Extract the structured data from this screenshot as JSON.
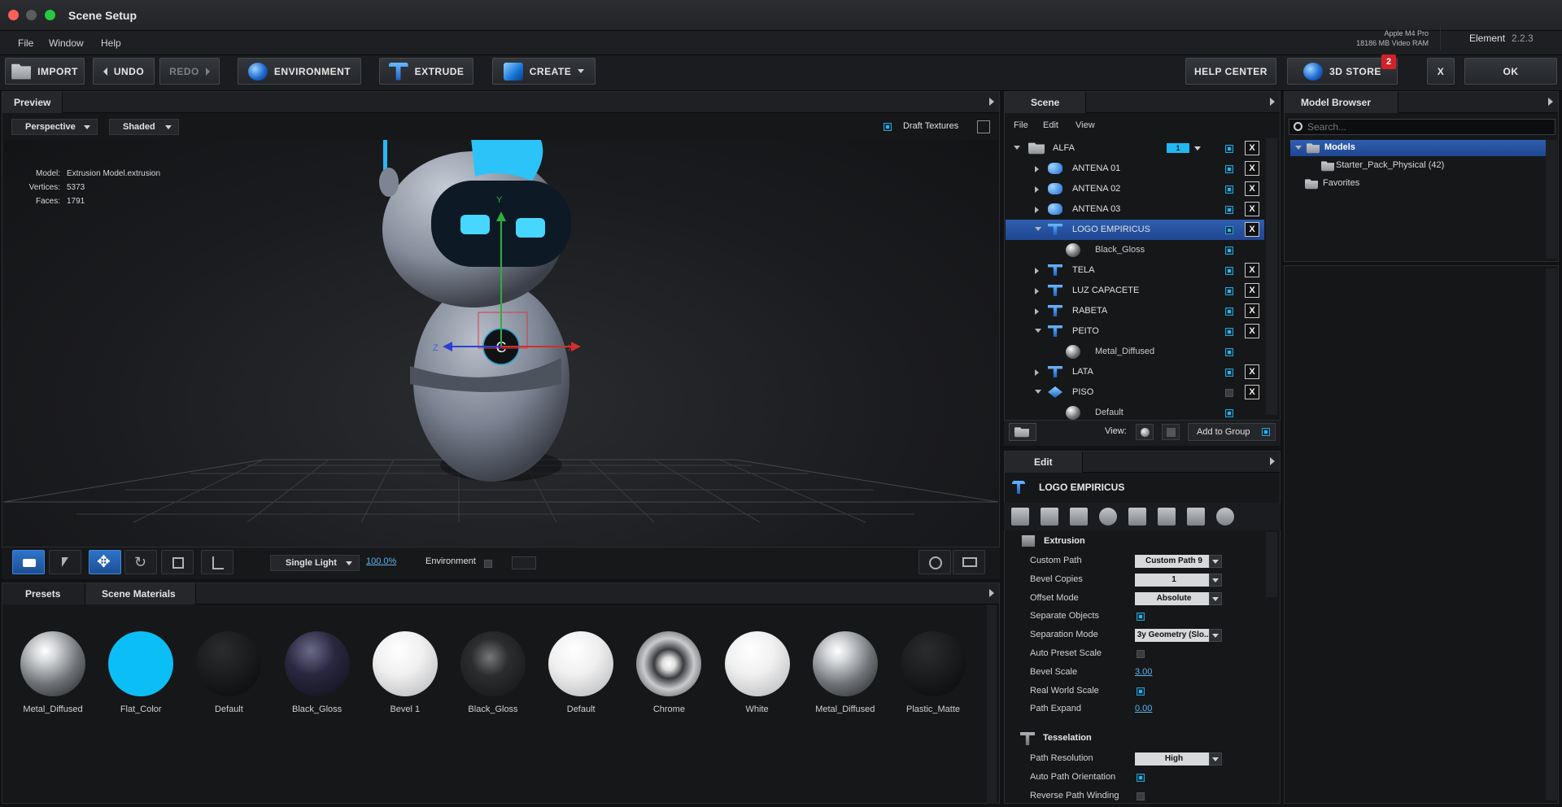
{
  "window": {
    "title": "Scene Setup"
  },
  "menu": [
    "File",
    "Window",
    "Help"
  ],
  "system": {
    "gpu": "Apple M4 Pro",
    "vram": "18186 MB Video RAM",
    "app": "Element",
    "version": "2.2.3"
  },
  "toolbar": {
    "import": "IMPORT",
    "undo": "UNDO",
    "redo": "REDO",
    "environment": "ENVIRONMENT",
    "extrude": "EXTRUDE",
    "create": "CREATE",
    "help_center": "HELP CENTER",
    "store": "3D STORE",
    "store_badge": "2",
    "close": "X",
    "ok": "OK"
  },
  "preview": {
    "tab": "Preview",
    "camera": "Perspective",
    "shading": "Shaded",
    "draft_textures": "Draft Textures",
    "model_label": "Model:",
    "model_value": "Extrusion Model.extrusion",
    "vertices_label": "Vertices:",
    "vertices_value": "5373",
    "faces_label": "Faces:",
    "faces_value": "1791",
    "light": "Single Light",
    "light_pct": "100.0%",
    "environment": "Environment",
    "axis_x": "X",
    "axis_y": "Y",
    "axis_z": "Z"
  },
  "scene": {
    "tab": "Scene",
    "menu": [
      "File",
      "Edit",
      "View"
    ],
    "root": {
      "label": "ALFA",
      "count": "1"
    },
    "items": [
      {
        "label": "ANTENA 01",
        "kind": "cyl"
      },
      {
        "label": "ANTENA 02",
        "kind": "cyl"
      },
      {
        "label": "ANTENA 03",
        "kind": "cyl"
      },
      {
        "label": "LOGO EMPIRICUS",
        "kind": "ext",
        "open": true,
        "selected": true
      },
      {
        "label": "Black_Gloss",
        "kind": "mat",
        "child": true
      },
      {
        "label": "TELA",
        "kind": "ext"
      },
      {
        "label": "LUZ CAPACETE",
        "kind": "ext"
      },
      {
        "label": "RABETA",
        "kind": "ext"
      },
      {
        "label": "PEITO",
        "kind": "ext",
        "open": true
      },
      {
        "label": "Metal_Diffused",
        "kind": "mat",
        "child": true
      },
      {
        "label": "LATA",
        "kind": "ext"
      },
      {
        "label": "PISO",
        "kind": "plane",
        "open": true
      },
      {
        "label": "Default",
        "kind": "mat",
        "child": true
      }
    ],
    "view_label": "View:",
    "add_to_group": "Add to Group"
  },
  "model_browser": {
    "tab": "Model Browser",
    "search_placeholder": "Search...",
    "tree": [
      {
        "label": "Models",
        "level": 0
      },
      {
        "label": "Starter_Pack_Physical (42)",
        "level": 1
      },
      {
        "label": "Favorites",
        "level": 0
      }
    ]
  },
  "edit": {
    "tab": "Edit",
    "object": "LOGO EMPIRICUS",
    "extrusion_header": "Extrusion",
    "rows": [
      {
        "label": "Custom Path",
        "type": "dd",
        "value": "Custom Path 9"
      },
      {
        "label": "Bevel Copies",
        "type": "dd",
        "value": "1"
      },
      {
        "label": "Offset Mode",
        "type": "dd",
        "value": "Absolute"
      },
      {
        "label": "Separate Objects",
        "type": "chk",
        "on": true
      },
      {
        "label": "Separation Mode",
        "type": "dd",
        "value": "3y Geometry (Slo..."
      },
      {
        "label": "Auto Preset Scale",
        "type": "chk",
        "on": false
      },
      {
        "label": "Bevel Scale",
        "type": "link",
        "value": "3.00"
      },
      {
        "label": "Real World Scale",
        "type": "chk",
        "on": true
      },
      {
        "label": "Path Expand",
        "type": "link",
        "value": "0.00"
      }
    ],
    "tesselation_header": "Tesselation",
    "rows2": [
      {
        "label": "Path Resolution",
        "type": "dd",
        "value": "High"
      },
      {
        "label": "Auto Path Orientation",
        "type": "chk",
        "on": true
      },
      {
        "label": "Reverse Path Winding",
        "type": "chk",
        "on": false
      }
    ]
  },
  "presets": {
    "tabs": [
      "Presets",
      "Scene Materials"
    ],
    "materials": [
      {
        "name": "Metal_Diffused",
        "style": "metal"
      },
      {
        "name": "Flat_Color",
        "style": "cyan"
      },
      {
        "name": "Default",
        "style": "dark"
      },
      {
        "name": "Black_Gloss",
        "style": "purple"
      },
      {
        "name": "Bevel 1",
        "style": "white"
      },
      {
        "name": "Black_Gloss",
        "style": "blackgloss"
      },
      {
        "name": "Default",
        "style": "white"
      },
      {
        "name": "Chrome",
        "style": "chrome"
      },
      {
        "name": "White",
        "style": "white"
      },
      {
        "name": "Metal_Diffused",
        "style": "metal"
      },
      {
        "name": "Plastic_Matte",
        "style": "dark"
      }
    ]
  }
}
